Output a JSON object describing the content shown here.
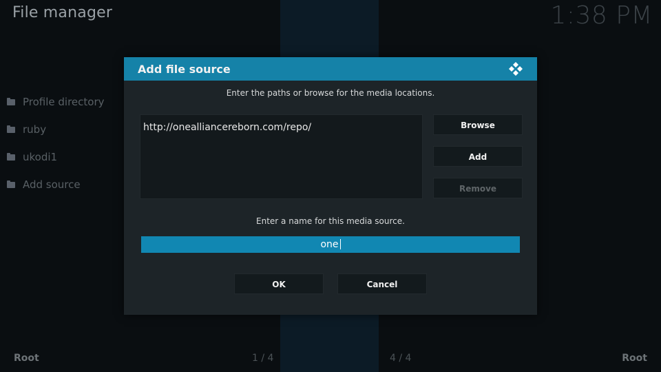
{
  "header": {
    "title": "File manager",
    "clock": "1:38 PM"
  },
  "sidebar": {
    "items": [
      {
        "label": "Profile directory",
        "icon": "folder-icon"
      },
      {
        "label": "ruby",
        "icon": "folder-icon"
      },
      {
        "label": "ukodi1",
        "icon": "folder-icon"
      },
      {
        "label": "Add source",
        "icon": "folder-icon"
      }
    ]
  },
  "footer": {
    "left_label": "Root",
    "left_page": "1 / 4",
    "right_page": "4 / 4",
    "right_label": "Root"
  },
  "dialog": {
    "title": "Add file source",
    "paths_instruction": "Enter the paths or browse for the media locations.",
    "paths": [
      "http://onealliancereborn.com/repo/"
    ],
    "browse_label": "Browse",
    "add_label": "Add",
    "remove_label": "Remove",
    "name_instruction": "Enter a name for this media source.",
    "name_value": "one",
    "ok_label": "OK",
    "cancel_label": "Cancel"
  },
  "colors": {
    "accent": "#1582a8",
    "input_focus": "#1187b2",
    "dialog_bg": "#1d2428"
  }
}
